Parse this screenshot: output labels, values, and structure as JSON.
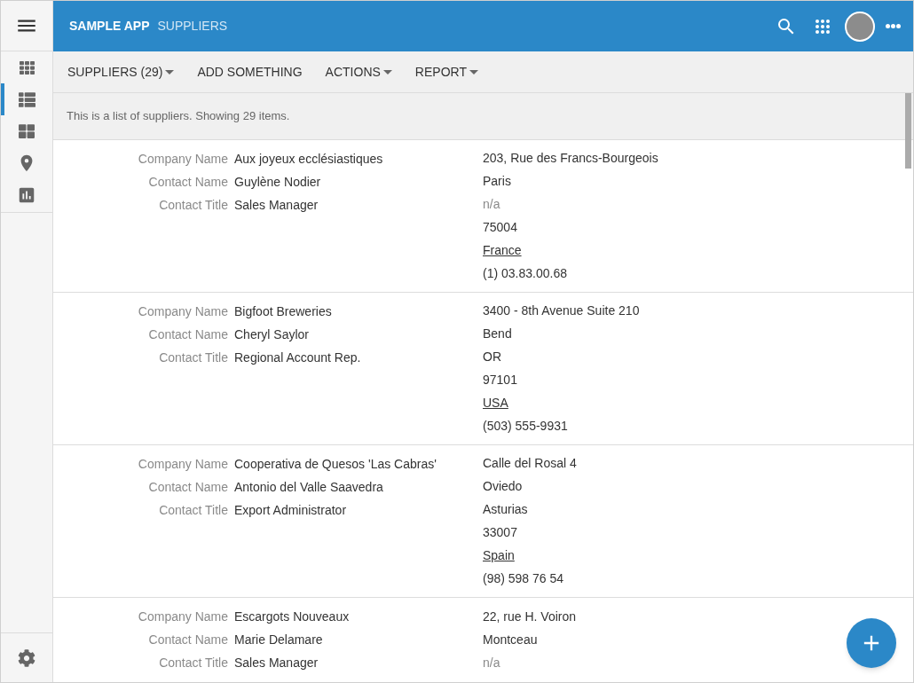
{
  "sidebar": {
    "items": [
      {
        "selected": false
      },
      {
        "selected": true
      },
      {
        "selected": false
      },
      {
        "selected": false
      },
      {
        "selected": false
      }
    ]
  },
  "header": {
    "app_name": "SAMPLE APP",
    "page_title": "SUPPLIERS"
  },
  "toolbar": {
    "items": [
      {
        "label": "SUPPLIERS (29)",
        "kind": "dropdown"
      },
      {
        "label": "ADD SOMETHING",
        "kind": "button"
      },
      {
        "label": "ACTIONS",
        "kind": "dropdown"
      },
      {
        "label": "REPORT",
        "kind": "dropdown"
      }
    ]
  },
  "info": "This is a list of suppliers. Showing 29 items.",
  "suppliers": [
    {
      "fields": [
        {
          "label": "Company Name",
          "value": "Aux joyeux ecclésiastiques"
        },
        {
          "label": "Contact Name",
          "value": "Guylène Nodier"
        },
        {
          "label": "Contact Title",
          "value": "Sales Manager"
        }
      ],
      "address": [
        {
          "text": "203, Rue des Francs-Bourgeois",
          "kind": "text"
        },
        {
          "text": "Paris",
          "kind": "text"
        },
        {
          "text": "n/a",
          "kind": "missing"
        },
        {
          "text": "75004",
          "kind": "text"
        },
        {
          "text": "France",
          "kind": "link"
        },
        {
          "text": "(1) 03.83.00.68",
          "kind": "text"
        }
      ]
    },
    {
      "fields": [
        {
          "label": "Company Name",
          "value": "Bigfoot Breweries"
        },
        {
          "label": "Contact Name",
          "value": "Cheryl Saylor"
        },
        {
          "label": "Contact Title",
          "value": "Regional Account Rep."
        }
      ],
      "address": [
        {
          "text": "3400 - 8th Avenue Suite 210",
          "kind": "text"
        },
        {
          "text": "Bend",
          "kind": "text"
        },
        {
          "text": "OR",
          "kind": "text"
        },
        {
          "text": "97101",
          "kind": "text"
        },
        {
          "text": "USA",
          "kind": "link"
        },
        {
          "text": "(503) 555-9931",
          "kind": "text"
        }
      ]
    },
    {
      "fields": [
        {
          "label": "Company Name",
          "value": "Cooperativa de Quesos 'Las Cabras'"
        },
        {
          "label": "Contact Name",
          "value": "Antonio del Valle Saavedra"
        },
        {
          "label": "Contact Title",
          "value": "Export Administrator"
        }
      ],
      "address": [
        {
          "text": "Calle del Rosal 4",
          "kind": "text"
        },
        {
          "text": "Oviedo",
          "kind": "text"
        },
        {
          "text": "Asturias",
          "kind": "text"
        },
        {
          "text": "33007",
          "kind": "text"
        },
        {
          "text": "Spain",
          "kind": "link"
        },
        {
          "text": "(98) 598 76 54",
          "kind": "text"
        }
      ]
    },
    {
      "fields": [
        {
          "label": "Company Name",
          "value": "Escargots Nouveaux"
        },
        {
          "label": "Contact Name",
          "value": "Marie Delamare"
        },
        {
          "label": "Contact Title",
          "value": "Sales Manager"
        }
      ],
      "address": [
        {
          "text": "22, rue H. Voiron",
          "kind": "text"
        },
        {
          "text": "Montceau",
          "kind": "text"
        },
        {
          "text": "n/a",
          "kind": "missing"
        }
      ]
    }
  ]
}
